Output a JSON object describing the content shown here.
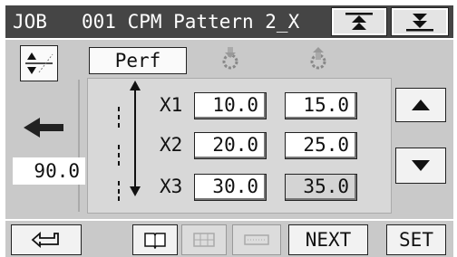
{
  "header": {
    "job_label": "JOB",
    "title": "001 CPM Pattern 2_X"
  },
  "mode": {
    "label": "Perf"
  },
  "value_display": "90.0",
  "rows": [
    {
      "label": "X1",
      "start": "10.0",
      "end": "15.0"
    },
    {
      "label": "X2",
      "start": "20.0",
      "end": "25.0"
    },
    {
      "label": "X3",
      "start": "30.0",
      "end": "35.0"
    }
  ],
  "footer": {
    "next_label": "NEXT",
    "set_label": "SET"
  },
  "colors": {
    "header_bg": "#454545",
    "panel_bg": "#c9c9c9",
    "inner_bg": "#d8d8d8"
  },
  "icons": {
    "page_up": "double-chevron-up-icon",
    "page_down": "double-chevron-down-icon",
    "mode": "cutter-icon",
    "back": "left-arrow-icon",
    "return": "return-icon",
    "book": "book-icon",
    "grid": "grid-icon",
    "dotted": "dotted-line-icon",
    "scroll_up": "triangle-up-icon",
    "scroll_down": "triangle-down-icon"
  }
}
